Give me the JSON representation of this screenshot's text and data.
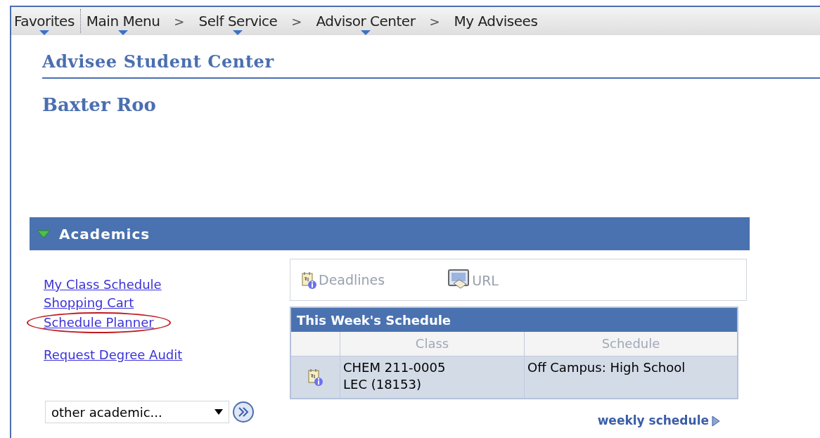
{
  "breadcrumbs": [
    {
      "kind": "link",
      "label": "Favorites",
      "dropdown": true
    },
    {
      "kind": "divider"
    },
    {
      "kind": "link",
      "label": "Main Menu",
      "dropdown": true
    },
    {
      "kind": "arrow",
      "text": ">"
    },
    {
      "kind": "link",
      "label": "Self Service",
      "dropdown": true
    },
    {
      "kind": "arrow",
      "text": ">"
    },
    {
      "kind": "link",
      "label": "Advisor Center",
      "dropdown": true
    },
    {
      "kind": "arrow",
      "text": ">"
    },
    {
      "kind": "link",
      "label": "My Advisees",
      "dropdown": false
    }
  ],
  "page_title": "Advisee Student Center",
  "student_name": "Baxter Roo",
  "section": {
    "title": "Academics",
    "expanded": true
  },
  "link_groups": [
    [
      {
        "label": "My Class Schedule",
        "circled": false
      },
      {
        "label": "Shopping Cart",
        "circled": false
      },
      {
        "label": "Schedule Planner",
        "circled": true
      }
    ],
    [
      {
        "label": "Request Degree Audit",
        "circled": false
      }
    ]
  ],
  "other_select": {
    "value": "other academic..."
  },
  "tools": [
    {
      "kind": "deadlines",
      "label": "Deadlines"
    },
    {
      "kind": "url",
      "label": "URL"
    }
  ],
  "schedule": {
    "title": "This Week's Schedule",
    "columns": [
      "Class",
      "Schedule"
    ],
    "rows": [
      {
        "class_lines": [
          "CHEM 211-0005",
          "LEC (18153)"
        ],
        "schedule": "Off Campus: High School"
      }
    ]
  },
  "weekly_link": "weekly schedule"
}
